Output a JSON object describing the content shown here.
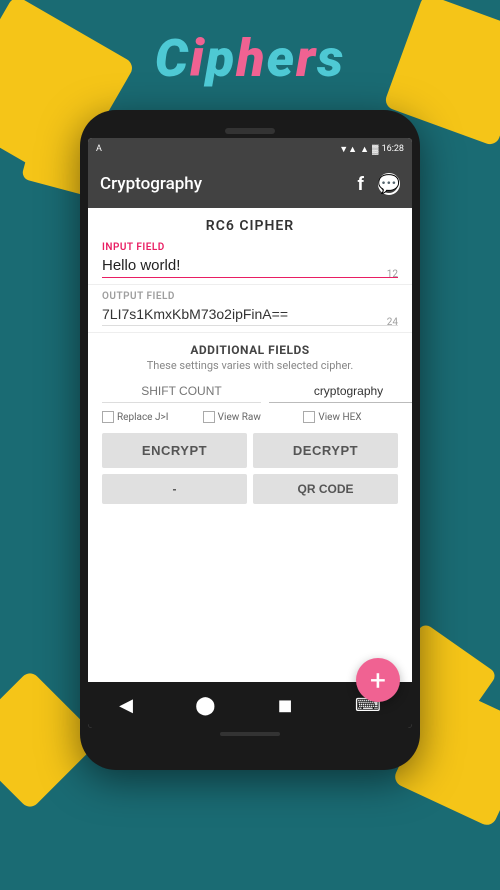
{
  "app_title": {
    "letters": [
      "C",
      "i",
      "p",
      "h",
      "e",
      "r",
      "s"
    ],
    "full": "Ciphers"
  },
  "status_bar": {
    "left_icon": "A",
    "wifi": "▼▲",
    "signal": "▲",
    "battery": "▓",
    "time": "16:28"
  },
  "header": {
    "title": "Cryptography",
    "facebook_icon": "f",
    "whatsapp_icon": "W"
  },
  "cipher": {
    "title": "RC6 CIPHER"
  },
  "input_field": {
    "label": "INPUT FIELD",
    "value": "Hello world!",
    "char_count": "12"
  },
  "output_field": {
    "label": "OUTPUT FIELD",
    "value": "7LI7s1KmxKbM73o2ipFinA==",
    "char_count": "24"
  },
  "additional_fields": {
    "title": "ADDITIONAL FIELDS",
    "description": "These settings varies with selected cipher.",
    "shift_count_placeholder": "SHIFT COUNT",
    "key_value": "cryptography",
    "checkbox1_label": "Replace J>I",
    "checkbox2_label": "View Raw",
    "checkbox3_label": "View HEX"
  },
  "buttons": {
    "encrypt_label": "ENCRYPT",
    "decrypt_label": "DECRYPT",
    "minus_label": "-",
    "qr_code_label": "QR CODE"
  },
  "fab": {
    "icon": "+"
  },
  "nav": {
    "back_icon": "◀",
    "home_icon": "⬤",
    "recent_icon": "◼",
    "keyboard_icon": "⌨"
  }
}
